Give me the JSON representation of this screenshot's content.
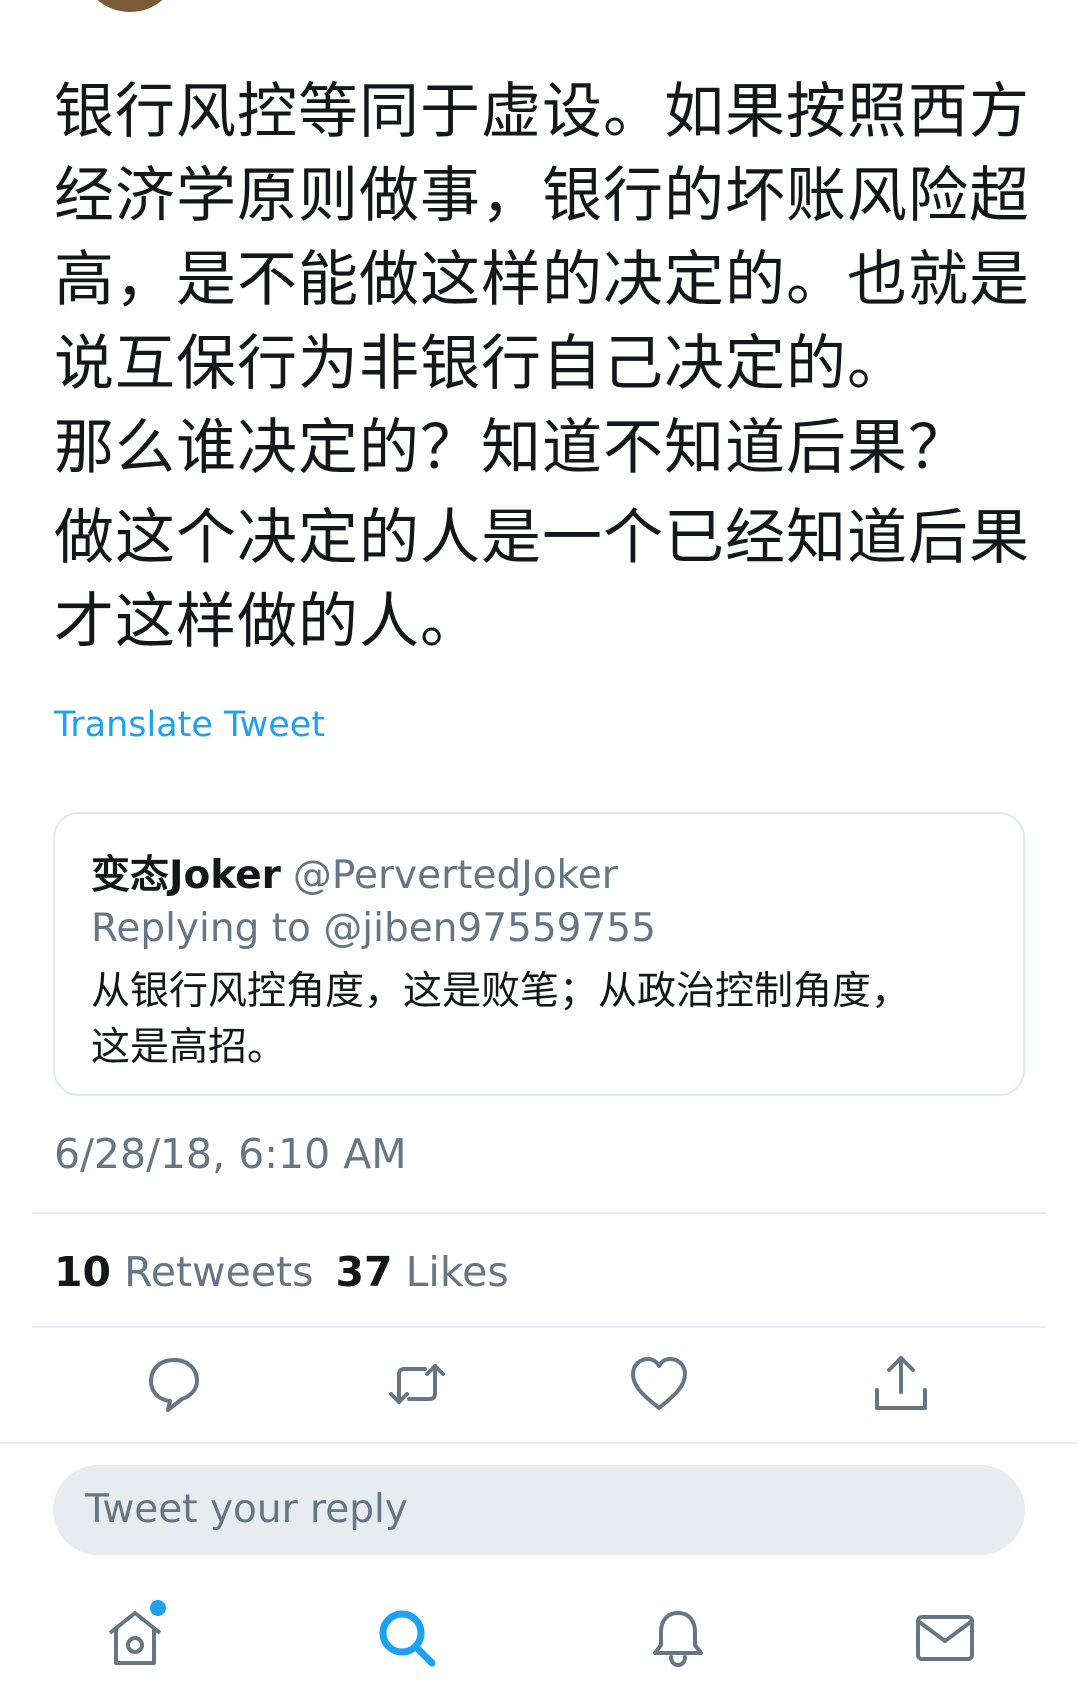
{
  "tweet": {
    "paragraphs": [
      "银行风控等同于虚设。如果按照西方\n经济学原则做事，银行的坏账风险超\n高，是不能做这样的决定的。也就是\n说互保行为非银行自己决定的。\n那么谁决定的？知道不知道后果？",
      "做这个决定的人是一个已经知道后果\n才这样做的人。"
    ],
    "translate_label": "Translate Tweet",
    "timestamp": "6/28/18, 6:10 AM"
  },
  "quoted": {
    "name": "变态Joker",
    "handle": "@PervertedJoker",
    "replying_to": "Replying to @jiben97559755",
    "text": "从银行风控角度，这是败笔；从政治控制角度，\n这是高招。"
  },
  "stats": {
    "retweets_count": "10",
    "retweets_label": "Retweets",
    "likes_count": "37",
    "likes_label": "Likes"
  },
  "actions": [
    {
      "name": "reply-icon"
    },
    {
      "name": "retweet-icon"
    },
    {
      "name": "like-icon"
    },
    {
      "name": "share-icon"
    }
  ],
  "reply": {
    "placeholder": "Tweet your reply"
  },
  "tabbar": {
    "items": [
      {
        "name": "home-icon",
        "active": false,
        "badge": true
      },
      {
        "name": "search-icon",
        "active": true
      },
      {
        "name": "notifications-icon",
        "active": false
      },
      {
        "name": "messages-icon",
        "active": false
      }
    ]
  },
  "colors": {
    "accent": "#1da1f2",
    "secondary_text": "#657786",
    "primary_text": "#14171a",
    "divider": "#e6ecf0"
  }
}
